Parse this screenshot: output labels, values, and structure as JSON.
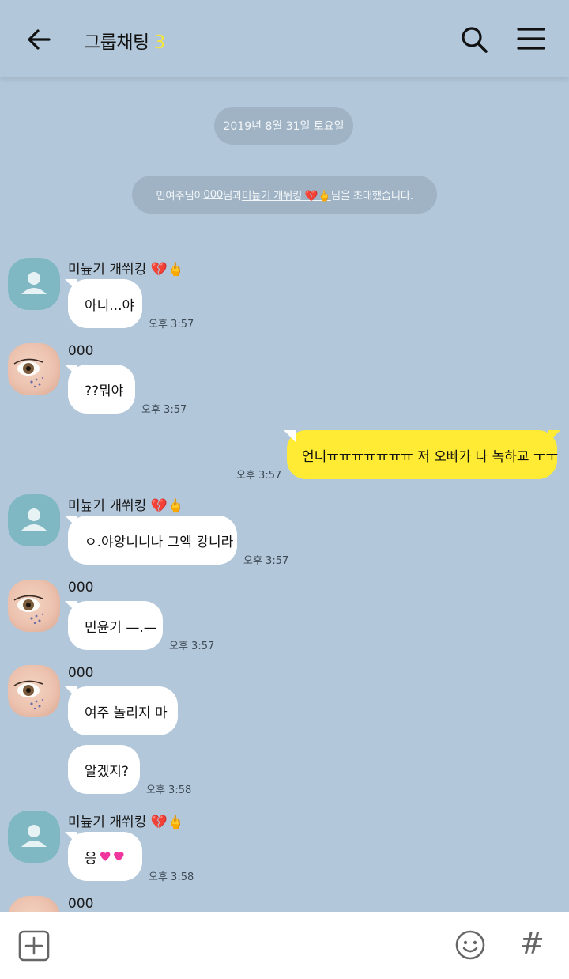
{
  "header": {
    "title": "그룹채팅",
    "count": "3"
  },
  "date_divider": "2019년 8월 31일 토요일",
  "system_message": {
    "prefix": "민여주님이 ",
    "user1": "000",
    "middle": "님과 ",
    "user2": "미늎기 개쒸킹 💔🖕",
    "suffix": "님을 초대했습니다."
  },
  "messages": [
    {
      "sender": "미늎기 개쒸킹",
      "sender_emoji": "💔🖕",
      "text": "아니...야",
      "time": "오후 3:57"
    },
    {
      "sender": "000",
      "text": "??뭐야",
      "time": "오후 3:57"
    },
    {
      "sender": "me",
      "text": "언니ㅠㅠㅠㅠㅠㅠㅠ 저 오빠가 나 녹하교 ㅜㅜ",
      "time": "오후 3:57"
    },
    {
      "sender": "미늎기 개쒸킹",
      "sender_emoji": "💔🖕",
      "text": "ㅇ.야앙니니나 그엑 캉니라",
      "time": "오후 3:57"
    },
    {
      "sender": "000",
      "text": "민윤기 —.—",
      "time": "오후 3:57"
    },
    {
      "sender": "000",
      "text": "여주 놀리지 마",
      "time": ""
    },
    {
      "sender": "000",
      "text": "알겠지?",
      "time": "오후 3:58"
    },
    {
      "sender": "미늎기 개쒸킹",
      "sender_emoji": "💔🖕",
      "text": "응",
      "time": "오후 3:58"
    },
    {
      "sender": "000",
      "text": ""
    }
  ],
  "colors": {
    "background": "#b2c7da",
    "my_bubble": "#ffeb33",
    "other_bubble": "#ffffff",
    "member_count": "#f5e63a"
  },
  "icons": [
    "back-arrow-icon",
    "search-icon",
    "menu-icon",
    "plus-icon",
    "emoticon-icon",
    "hashtag-icon"
  ]
}
